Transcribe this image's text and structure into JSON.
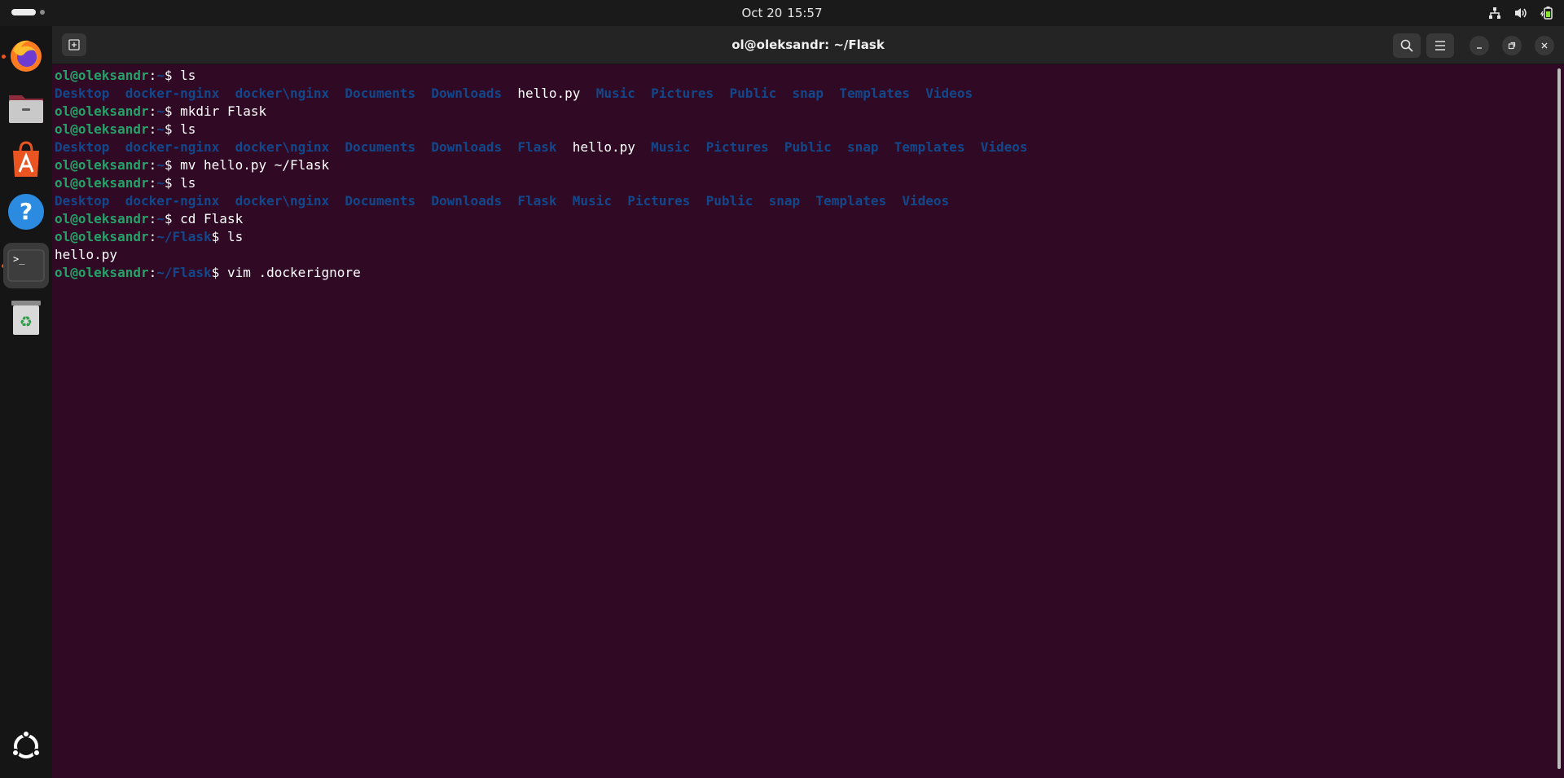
{
  "topbar": {
    "date": "Oct 20",
    "time": "15:57",
    "tray_icons": [
      "network-icon",
      "volume-icon",
      "battery-icon"
    ]
  },
  "dock": {
    "items": [
      {
        "name": "firefox-icon",
        "running": true
      },
      {
        "name": "files-icon",
        "running": false
      },
      {
        "name": "app-center-icon",
        "running": false
      },
      {
        "name": "help-icon",
        "running": false
      },
      {
        "name": "terminal-icon",
        "running": true,
        "active": true
      },
      {
        "name": "trash-icon",
        "running": false
      }
    ],
    "apps_grid": "show-apps-icon"
  },
  "window": {
    "title": "ol@oleksandr: ~/Flask"
  },
  "colors": {
    "terminal_bg": "#300a24",
    "prompt_user": "#26a269",
    "prompt_path": "#12488b",
    "dir": "#12488b",
    "accent": "#e95420"
  },
  "terminal": {
    "lines": [
      {
        "type": "prompt",
        "user": "ol@oleksandr",
        "path": "~",
        "cmd": "ls"
      },
      {
        "type": "ls",
        "items": [
          {
            "t": "Desktop",
            "k": "dir"
          },
          {
            "t": "docker-nginx",
            "k": "dir"
          },
          {
            "t": "docker\\nginx",
            "k": "dir"
          },
          {
            "t": "Documents",
            "k": "dir"
          },
          {
            "t": "Downloads",
            "k": "dir"
          },
          {
            "t": "hello.py",
            "k": "file"
          },
          {
            "t": "Music",
            "k": "dir"
          },
          {
            "t": "Pictures",
            "k": "dir"
          },
          {
            "t": "Public",
            "k": "dir"
          },
          {
            "t": "snap",
            "k": "dir"
          },
          {
            "t": "Templates",
            "k": "dir"
          },
          {
            "t": "Videos",
            "k": "dir"
          }
        ]
      },
      {
        "type": "prompt",
        "user": "ol@oleksandr",
        "path": "~",
        "cmd": "mkdir Flask"
      },
      {
        "type": "prompt",
        "user": "ol@oleksandr",
        "path": "~",
        "cmd": "ls"
      },
      {
        "type": "ls",
        "items": [
          {
            "t": "Desktop",
            "k": "dir"
          },
          {
            "t": "docker-nginx",
            "k": "dir"
          },
          {
            "t": "docker\\nginx",
            "k": "dir"
          },
          {
            "t": "Documents",
            "k": "dir"
          },
          {
            "t": "Downloads",
            "k": "dir"
          },
          {
            "t": "Flask",
            "k": "dir"
          },
          {
            "t": "hello.py",
            "k": "file"
          },
          {
            "t": "Music",
            "k": "dir"
          },
          {
            "t": "Pictures",
            "k": "dir"
          },
          {
            "t": "Public",
            "k": "dir"
          },
          {
            "t": "snap",
            "k": "dir"
          },
          {
            "t": "Templates",
            "k": "dir"
          },
          {
            "t": "Videos",
            "k": "dir"
          }
        ]
      },
      {
        "type": "prompt",
        "user": "ol@oleksandr",
        "path": "~",
        "cmd": "mv hello.py ~/Flask"
      },
      {
        "type": "prompt",
        "user": "ol@oleksandr",
        "path": "~",
        "cmd": "ls"
      },
      {
        "type": "ls",
        "items": [
          {
            "t": "Desktop",
            "k": "dir"
          },
          {
            "t": "docker-nginx",
            "k": "dir"
          },
          {
            "t": "docker\\nginx",
            "k": "dir"
          },
          {
            "t": "Documents",
            "k": "dir"
          },
          {
            "t": "Downloads",
            "k": "dir"
          },
          {
            "t": "Flask",
            "k": "dir"
          },
          {
            "t": "Music",
            "k": "dir"
          },
          {
            "t": "Pictures",
            "k": "dir"
          },
          {
            "t": "Public",
            "k": "dir"
          },
          {
            "t": "snap",
            "k": "dir"
          },
          {
            "t": "Templates",
            "k": "dir"
          },
          {
            "t": "Videos",
            "k": "dir"
          }
        ]
      },
      {
        "type": "prompt",
        "user": "ol@oleksandr",
        "path": "~",
        "cmd": "cd Flask"
      },
      {
        "type": "prompt",
        "user": "ol@oleksandr",
        "path": "~/Flask",
        "cmd": "ls"
      },
      {
        "type": "ls",
        "items": [
          {
            "t": "hello.py",
            "k": "file"
          }
        ]
      },
      {
        "type": "prompt",
        "user": "ol@oleksandr",
        "path": "~/Flask",
        "cmd": "vim .dockerignore"
      }
    ]
  }
}
